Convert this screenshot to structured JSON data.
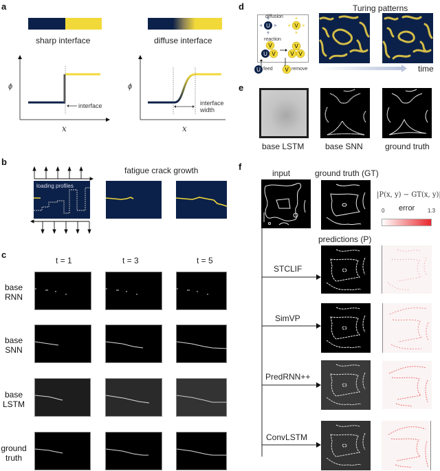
{
  "panels": {
    "a": {
      "letter": "a",
      "sharp": {
        "title": "sharp interface",
        "y_axis": "ϕ",
        "x_axis": "x",
        "annotation": "interface"
      },
      "diffuse": {
        "title": "diffuse interface",
        "y_axis": "ϕ",
        "x_axis": "x",
        "annotation_line1": "interface",
        "annotation_line2": "width"
      },
      "colors": {
        "navy": "#0c2149",
        "yellow": "#f2d93a"
      }
    },
    "b": {
      "letter": "b",
      "title": "fatigue crack growth",
      "inset_label": "loading profiles"
    },
    "c": {
      "letter": "c",
      "columns": [
        "t = 1",
        "t = 3",
        "t = 5"
      ],
      "rows": [
        {
          "label_line1": "base",
          "label_line2": "RNN"
        },
        {
          "label_line1": "base",
          "label_line2": "SNN"
        },
        {
          "label_line1": "base",
          "label_line2": "LSTM"
        },
        {
          "label_line1": "ground",
          "label_line2": "truth"
        }
      ]
    },
    "d": {
      "letter": "d",
      "title": "Turing patterns",
      "diagram": {
        "diffusion": "diffusion",
        "reaction": "reaction",
        "feed": "feed",
        "remove": "remove",
        "u": "U",
        "v": "V"
      },
      "time_label": "time"
    },
    "e": {
      "letter": "e",
      "labels": [
        "base LSTM",
        "base SNN",
        "ground truth"
      ]
    },
    "f": {
      "letter": "f",
      "input_label": "input",
      "gt_label": "ground truth (GT)",
      "pred_label": "predictions (P)",
      "formula": "|P(x, y) − GT(x, y)|",
      "colorbar": {
        "title": "error",
        "min": "0",
        "max": "1.3",
        "color": "#e8262c"
      },
      "models": [
        "STCLIF",
        "SimVP",
        "PredRNN++",
        "ConvLSTM"
      ]
    }
  }
}
